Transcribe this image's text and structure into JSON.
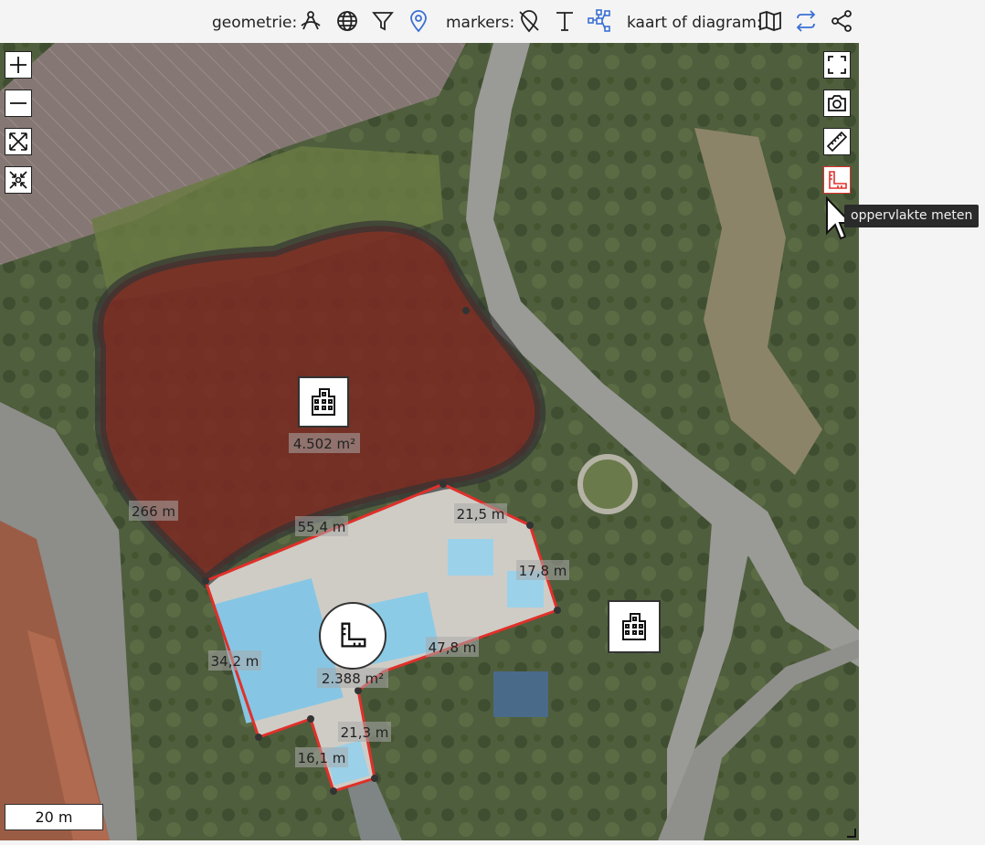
{
  "toolbar": {
    "geometry_label": "geometrie:",
    "markers_label": "markers:",
    "map_label": "kaart of diagram:",
    "icons": [
      "draw-icon",
      "globe-icon",
      "filter-icon",
      "location-pin-icon",
      "marker-off-icon",
      "text-icon",
      "network-icon",
      "map-icon",
      "swap-icon",
      "share-icon"
    ],
    "accent_color": "#3b6fd4"
  },
  "map_controls": {
    "zoom_in": "+",
    "zoom_out": "−"
  },
  "tooltip": {
    "text": "oppervlakte meten"
  },
  "scale": {
    "label": "20 m"
  },
  "measurements": {
    "area_large": "4.502 m²",
    "area_small": "2.388 m²",
    "perimeter_large": "266 m",
    "edge_1": "55,4 m",
    "edge_2": "21,5 m",
    "edge_3": "17,8 m",
    "edge_4": "47,8 m",
    "edge_5": "34,2 m",
    "edge_6": "21,3 m",
    "edge_7": "16,1 m"
  },
  "colors": {
    "polygon_fill": "#7a2a22",
    "measure_line": "#e0302a",
    "active_tool": "#e0302a"
  }
}
